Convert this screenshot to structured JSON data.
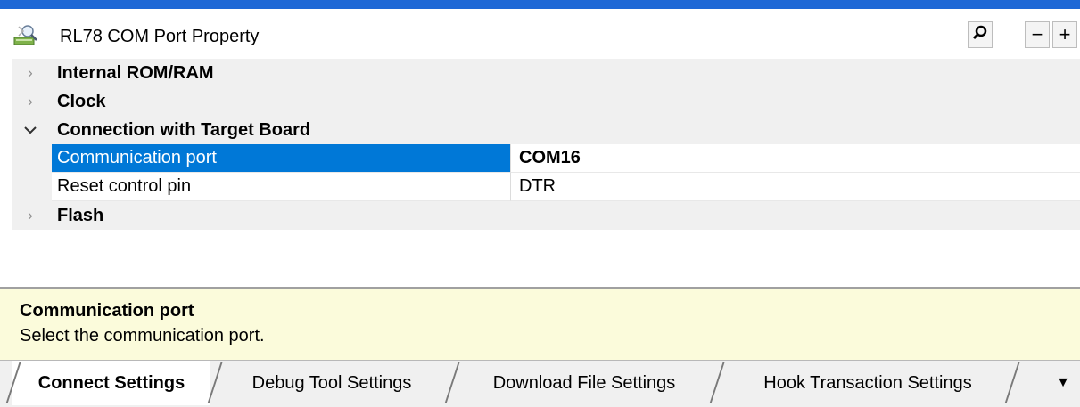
{
  "window": {
    "title": "RL78 COM Port Property",
    "buttons": {
      "search_icon": "magnifier-icon",
      "minus_label": "−",
      "plus_label": "+"
    }
  },
  "property_grid": {
    "categories": [
      {
        "label": "Internal ROM/RAM",
        "expanded": false,
        "arrow": "›"
      },
      {
        "label": "Clock",
        "expanded": false,
        "arrow": "›"
      },
      {
        "label": "Connection with Target Board",
        "expanded": true,
        "arrow": "⌄"
      },
      {
        "label": "Flash",
        "expanded": false,
        "arrow": "›"
      }
    ],
    "properties": [
      {
        "name": "Communication port",
        "value": "COM16",
        "selected": true,
        "has_dropdown": true
      },
      {
        "name": "Reset control pin",
        "value": "DTR",
        "selected": false,
        "has_dropdown": false
      }
    ],
    "dropdown_glyph": "⌵"
  },
  "help": {
    "title": "Communication port",
    "description": "Select the communication port."
  },
  "tabs": [
    {
      "label": "Connect Settings",
      "active": true
    },
    {
      "label": "Debug Tool Settings",
      "active": false
    },
    {
      "label": "Download File Settings",
      "active": false
    },
    {
      "label": "Hook Transaction Settings",
      "active": false
    }
  ],
  "tabs_overflow_glyph": "▼",
  "colors": {
    "accent": "#1e68d6",
    "selection": "#0078d7",
    "category_background": "#f0f0f0",
    "help_background": "#fbfbdb"
  }
}
